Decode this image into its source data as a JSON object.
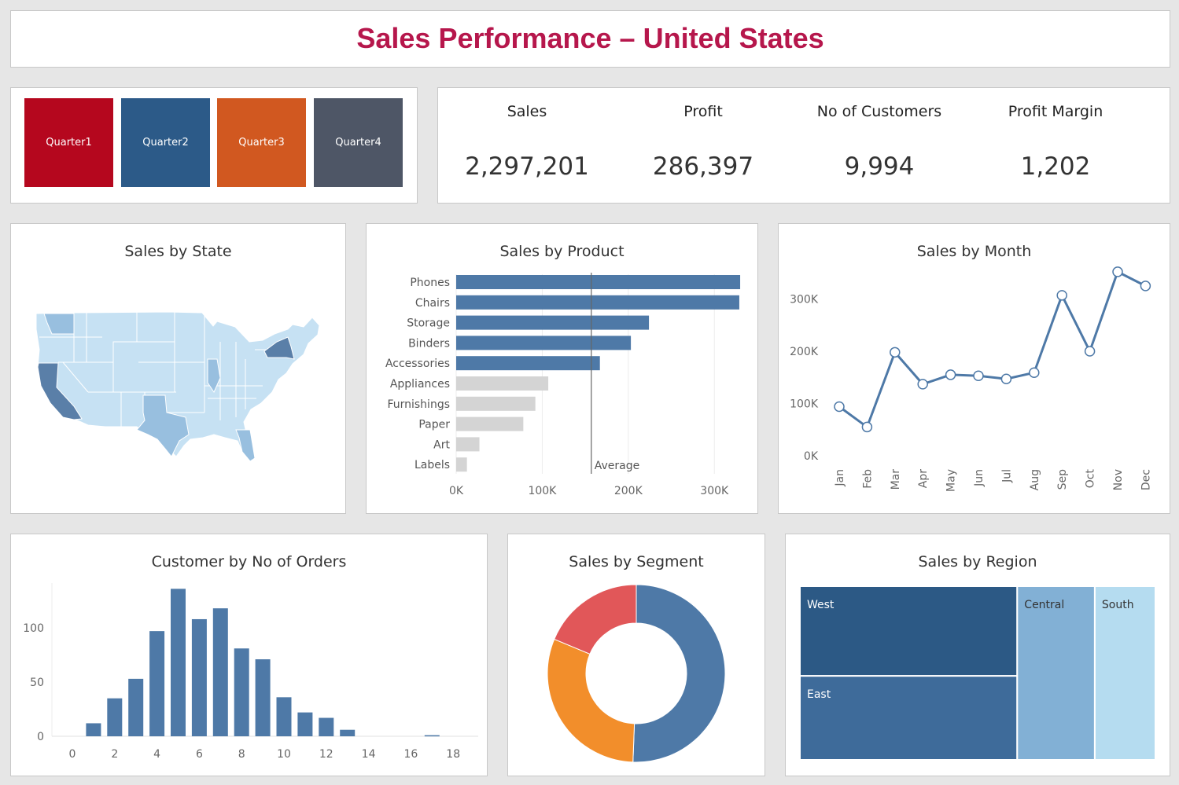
{
  "title": "Sales Performance – United States",
  "quarters": [
    {
      "label": "Quarter1",
      "color": "#b5071e"
    },
    {
      "label": "Quarter2",
      "color": "#2c5a88"
    },
    {
      "label": "Quarter3",
      "color": "#d15820"
    },
    {
      "label": "Quarter4",
      "color": "#4e5666"
    }
  ],
  "kpis": [
    {
      "label": "Sales",
      "value": "2,297,201"
    },
    {
      "label": "Profit",
      "value": "286,397"
    },
    {
      "label": "No of Customers",
      "value": "9,994"
    },
    {
      "label": "Profit Margin",
      "value": "1,202"
    }
  ],
  "panels": {
    "state": "Sales by State",
    "product": "Sales by Product",
    "month": "Sales by Month",
    "orders": "Customer by No of Orders",
    "segment": "Sales by Segment",
    "region": "Sales by Region"
  },
  "chart_data": [
    {
      "type": "map",
      "title": "Sales by State",
      "highlight_states": [
        "California",
        "Texas",
        "New York",
        "Washington"
      ],
      "colors": {
        "base": "#c6e1f3",
        "mid": "#98bfdf",
        "high": "#5a7fa8"
      }
    },
    {
      "type": "bar",
      "orientation": "horizontal",
      "title": "Sales by Product",
      "categories": [
        "Phones",
        "Chairs",
        "Storage",
        "Binders",
        "Accessories",
        "Appliances",
        "Furnishings",
        "Paper",
        "Art",
        "Labels"
      ],
      "values": [
        330000,
        329000,
        224000,
        203000,
        167000,
        107000,
        92000,
        78000,
        27000,
        12500
      ],
      "above_average_color": "#4e79a7",
      "below_average_color": "#d4d4d4",
      "reference_line": {
        "label": "Average",
        "value": 157000
      },
      "xticks": [
        "0K",
        "100K",
        "200K",
        "300K"
      ],
      "xlim": [
        0,
        340000
      ],
      "grid": true
    },
    {
      "type": "line",
      "title": "Sales by Month",
      "x": [
        "Jan",
        "Feb",
        "Mar",
        "Apr",
        "May",
        "Jun",
        "Jul",
        "Aug",
        "Sep",
        "Oct",
        "Nov",
        "Dec"
      ],
      "values": [
        94000,
        55000,
        198000,
        137000,
        155000,
        153000,
        147000,
        159000,
        307000,
        200000,
        352000,
        325000
      ],
      "yticks": [
        "0K",
        "100K",
        "200K",
        "300K"
      ],
      "color": "#4e79a7"
    },
    {
      "type": "bar",
      "title": "Customer by No of Orders",
      "x": [
        1,
        2,
        3,
        4,
        5,
        6,
        7,
        8,
        9,
        10,
        11,
        12,
        13,
        17
      ],
      "values": [
        12,
        35,
        53,
        97,
        136,
        108,
        118,
        81,
        71,
        36,
        22,
        17,
        6,
        1
      ],
      "yticks": [
        0,
        50,
        100
      ],
      "xticks": [
        0,
        2,
        4,
        6,
        8,
        10,
        12,
        14,
        16,
        18
      ],
      "color": "#4e79a7"
    },
    {
      "type": "pie",
      "title": "Sales by Segment",
      "donut": true,
      "slices": [
        {
          "value": 50.6,
          "color": "#4e79a7"
        },
        {
          "value": 30.7,
          "color": "#f28e2b"
        },
        {
          "value": 18.7,
          "color": "#e15759"
        }
      ]
    },
    {
      "type": "treemap",
      "title": "Sales by Region",
      "items": [
        {
          "name": "West",
          "value": 725458,
          "color": "#2c5985"
        },
        {
          "name": "East",
          "value": 678781,
          "color": "#3e6b9a"
        },
        {
          "name": "Central",
          "value": 501240,
          "color": "#82b0d5"
        },
        {
          "name": "South",
          "value": 391722,
          "color": "#b5dcf0"
        }
      ]
    }
  ]
}
